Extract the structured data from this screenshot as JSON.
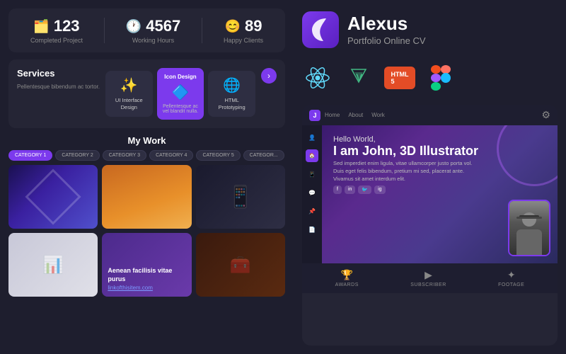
{
  "stats": {
    "items": [
      {
        "icon": "🗂️",
        "number": "123",
        "label": "Completed Project"
      },
      {
        "icon": "🕐",
        "number": "4567",
        "label": "Working Hours"
      },
      {
        "icon": "😊",
        "number": "89",
        "label": "Happy Clients"
      }
    ]
  },
  "services": {
    "title": "Services",
    "description": "Pellentesque bibendum ac tortor.",
    "cards": [
      {
        "icon": "✨",
        "label": "UI Interface Design",
        "active": false
      },
      {
        "icon": "🔷",
        "label": "Icon Design",
        "sublabel": "Pellentesque ac vel blandit nulla.",
        "active": true
      },
      {
        "icon": "🌐",
        "label": "HTML Prototyping",
        "active": false
      }
    ],
    "arrow_label": "›"
  },
  "mywork": {
    "title": "My Work",
    "categories": [
      {
        "label": "CATEGORY 1",
        "active": true
      },
      {
        "label": "CATEGORY 2",
        "active": false
      },
      {
        "label": "CATEGORY 3",
        "active": false
      },
      {
        "label": "CATEGORY 4",
        "active": false
      },
      {
        "label": "CATEGORY 5",
        "active": false
      },
      {
        "label": "CATEGOR...",
        "active": false
      }
    ],
    "portfolio_items": [
      {
        "type": "abstract-blue"
      },
      {
        "type": "orange-photo"
      },
      {
        "type": "phone-dark"
      },
      {
        "type": "tablet-light"
      },
      {
        "type": "purple-text",
        "title": "Aenean facilisis vitae purus",
        "link": "linkofthisitem.com"
      },
      {
        "type": "product-dark"
      }
    ]
  },
  "brand": {
    "name": "Alexus",
    "subtitle": "Portfolio Online CV",
    "logo_symbol": "("
  },
  "tech_stack": [
    {
      "name": "React",
      "symbol": "⚛",
      "color": "#61dafb"
    },
    {
      "name": "Vue",
      "symbol": "V",
      "color": "#42b883"
    },
    {
      "name": "HTML5",
      "symbol": "HTML5",
      "color": "#e34c26"
    },
    {
      "name": "Figma",
      "symbol": "✦",
      "color": "#a259ff"
    }
  ],
  "preview": {
    "greeting": "Hello World,",
    "headline": "I am John, 3D Illustrator",
    "bio": "Sed imperdiet enim ligula, vitae ullamcorper justo porta vol. Duis eget felis bibendum, pretium mi sed, placerat ante. Vivamus sit amet interdum elit.",
    "social": [
      "f",
      "in",
      "🐦",
      "ig"
    ],
    "stats": [
      {
        "icon": "🏆",
        "label": "AWARDS"
      },
      {
        "icon": "▶",
        "label": "SUBSCRIBER"
      },
      {
        "icon": "✦",
        "label": "FOOTAGE"
      }
    ],
    "nav_items": [
      "🏠 Home",
      "👤",
      "📱",
      "💬",
      "📌",
      "📄"
    ],
    "home_label": "Home"
  }
}
